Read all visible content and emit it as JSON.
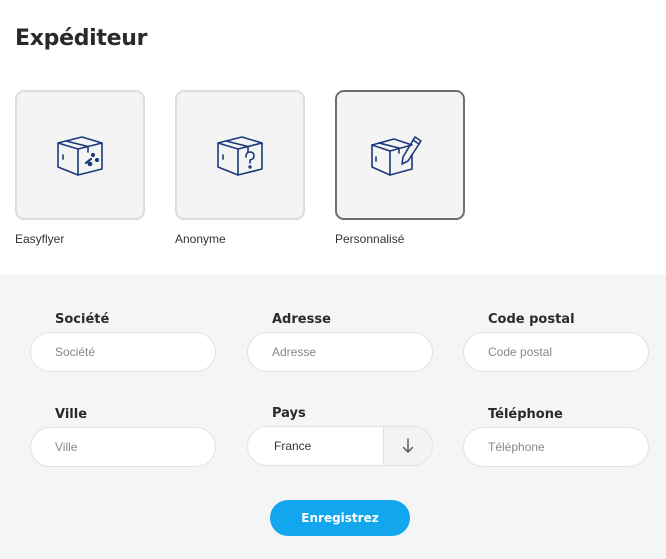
{
  "page": {
    "title": "Expéditeur"
  },
  "sender_options": [
    {
      "label": "Easyflyer",
      "icon": "box-logo-icon",
      "selected": false
    },
    {
      "label": "Anonyme",
      "icon": "box-question-icon",
      "selected": false
    },
    {
      "label": "Personnalisé",
      "icon": "box-pen-icon",
      "selected": true
    }
  ],
  "form": {
    "company": {
      "label": "Société",
      "placeholder": "Société"
    },
    "address": {
      "label": "Adresse",
      "placeholder": "Adresse"
    },
    "postal_code": {
      "label": "Code postal",
      "placeholder": "Code postal"
    },
    "city": {
      "label": "Ville",
      "placeholder": "Ville"
    },
    "country": {
      "label": "Pays",
      "value": "France"
    },
    "phone": {
      "label": "Téléphone",
      "placeholder": "Téléphone"
    },
    "submit_label": "Enregistrez"
  },
  "colors": {
    "icon": "#1b3a7a",
    "button": "#12a6ee",
    "selected_border": "#6e6e6e",
    "card_border": "#dcdcdc",
    "form_background": "#f5f5f5"
  }
}
